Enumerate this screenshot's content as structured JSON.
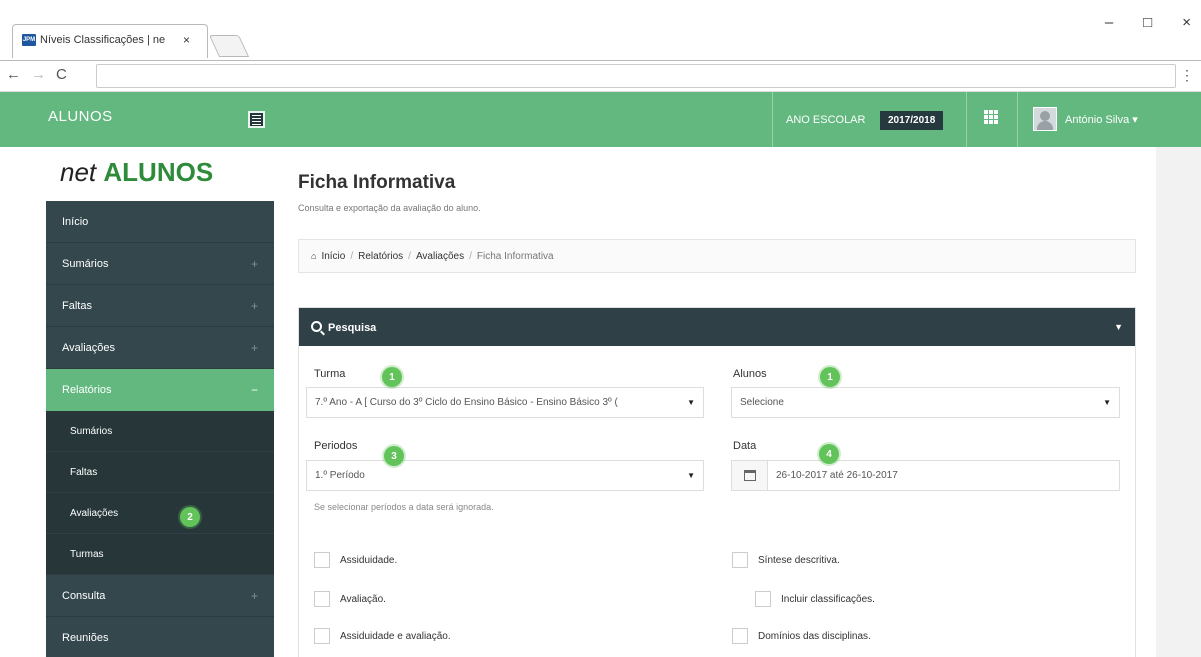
{
  "browser": {
    "tab_title": "Níveis Classificações | ne",
    "favicon_text": "JPM",
    "tab_close": "×",
    "win_min": "–",
    "win_max": "□",
    "win_close": "×",
    "nav_back": "←",
    "nav_forward": "→",
    "nav_reload": "C",
    "menu": "⋮"
  },
  "header": {
    "brand": "ALUNOS",
    "ano_label": "ANO ESCOLAR",
    "ano_value": "2017/2018",
    "user_name": "António Silva ▾"
  },
  "logo": {
    "net": "net",
    "alunos": "ALUNOS"
  },
  "sidebar": {
    "items": [
      {
        "label": "Início",
        "icon": ""
      },
      {
        "label": "Sumários",
        "icon": "+"
      },
      {
        "label": "Faltas",
        "icon": "+"
      },
      {
        "label": "Avaliações",
        "icon": "+"
      },
      {
        "label": "Relatórios",
        "icon": "−"
      },
      {
        "label": "Consulta",
        "icon": "+"
      },
      {
        "label": "Reuniões",
        "icon": ""
      }
    ],
    "subitems": [
      "Sumários",
      "Faltas",
      "Avaliações",
      "Turmas"
    ]
  },
  "page": {
    "title": "Ficha Informativa",
    "subtitle": "Consulta e exportação da avaliação do aluno."
  },
  "breadcrumb": [
    "Início",
    "Relatórios",
    "Avaliações",
    "Ficha Informativa"
  ],
  "breadcrumb_sep": "/",
  "panel": {
    "title": "Pesquisa",
    "caret": "▼"
  },
  "form": {
    "turma_label": "Turma",
    "turma_value": "7.º Ano - A [ Curso do 3º Ciclo do Ensino Básico - Ensino Básico 3º (",
    "alunos_label": "Alunos",
    "alunos_value": "Selecione",
    "periodos_label": "Periodos",
    "periodos_value": "1.º Período",
    "data_label": "Data",
    "data_value": "26-10-2017 até 26-10-2017",
    "help_text": "Se selecionar períodos a data será ignorada.",
    "select_arrow": "▼"
  },
  "checkboxes": {
    "assiduidade": "Assiduidade.",
    "avaliacao": "Avaliação.",
    "assiduidade_avaliacao": "Assiduidade e avaliação.",
    "sintese": "Síntese descritiva.",
    "incluir": "Incluir classificações.",
    "dominios": "Domínios das disciplinas."
  },
  "badges": [
    "1",
    "1",
    "2",
    "3",
    "4"
  ],
  "colors": {
    "green": "#62b87e",
    "dark": "#34474d",
    "badge": "#62c35a"
  }
}
